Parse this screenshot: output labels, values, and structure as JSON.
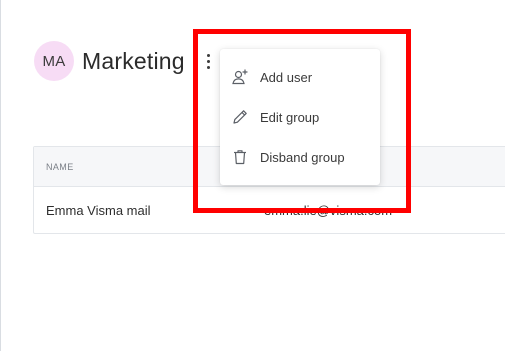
{
  "group": {
    "initials": "MA",
    "avatar_color": "#f7dcf5",
    "name": "Marketing",
    "more_icon": "more-vertical-icon"
  },
  "table": {
    "columns": [
      "NAME"
    ],
    "rows": [
      {
        "name": "Emma Visma mail",
        "email": "emma.lie@visma.com"
      }
    ]
  },
  "menu": {
    "items": [
      {
        "label": "Add user",
        "icon": "add-user-icon"
      },
      {
        "label": "Edit group",
        "icon": "pencil-icon"
      },
      {
        "label": "Disband group",
        "icon": "trash-icon"
      }
    ]
  },
  "highlight": {
    "color": "#ff0000"
  }
}
